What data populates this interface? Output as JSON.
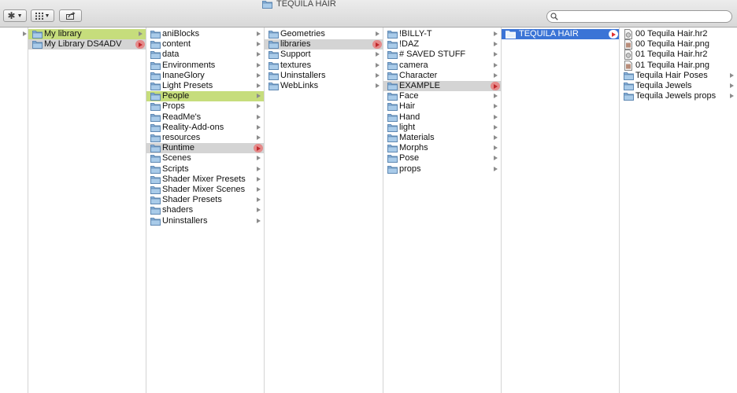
{
  "window": {
    "title": "TEQUILA HAIR"
  },
  "toolbar": {
    "search_placeholder": ""
  },
  "icons": {
    "action": "gear-icon",
    "view": "grid-view-icon",
    "share": "share-icon",
    "search": "search-icon",
    "folder": "folder-icon",
    "file": "file-icon"
  },
  "colors": {
    "green_selection": "#c6dd7c",
    "gray_selection": "#d4d4d4",
    "blue_selection": "#3b74d6",
    "arrow_pill": "#e58a8a"
  },
  "columns": [
    {
      "items": [
        {
          "name": "My library",
          "kind": "folder",
          "arrow": true,
          "state": "green"
        },
        {
          "name": "My Library DS4ADV",
          "kind": "folder",
          "arrow": true,
          "state": "gray",
          "pill": true
        }
      ]
    },
    {
      "items": [
        {
          "name": "aniBlocks",
          "kind": "folder",
          "arrow": true
        },
        {
          "name": "content",
          "kind": "folder",
          "arrow": true
        },
        {
          "name": "data",
          "kind": "folder",
          "arrow": true
        },
        {
          "name": "Environments",
          "kind": "folder",
          "arrow": true
        },
        {
          "name": "InaneGlory",
          "kind": "folder",
          "arrow": true
        },
        {
          "name": "Light Presets",
          "kind": "folder",
          "arrow": true
        },
        {
          "name": "People",
          "kind": "folder",
          "arrow": true,
          "state": "green"
        },
        {
          "name": "Props",
          "kind": "folder",
          "arrow": true
        },
        {
          "name": "ReadMe's",
          "kind": "folder",
          "arrow": true
        },
        {
          "name": "Reality-Add-ons",
          "kind": "folder",
          "arrow": true
        },
        {
          "name": "resources",
          "kind": "folder",
          "arrow": true
        },
        {
          "name": "Runtime",
          "kind": "folder",
          "arrow": true,
          "state": "gray",
          "pill": true
        },
        {
          "name": "Scenes",
          "kind": "folder",
          "arrow": true
        },
        {
          "name": "Scripts",
          "kind": "folder",
          "arrow": true
        },
        {
          "name": "Shader Mixer Presets",
          "kind": "folder",
          "arrow": true
        },
        {
          "name": "Shader Mixer Scenes",
          "kind": "folder",
          "arrow": true
        },
        {
          "name": "Shader Presets",
          "kind": "folder",
          "arrow": true
        },
        {
          "name": "shaders",
          "kind": "folder",
          "arrow": true
        },
        {
          "name": "Uninstallers",
          "kind": "folder",
          "arrow": true
        }
      ]
    },
    {
      "items": [
        {
          "name": "Geometries",
          "kind": "folder",
          "arrow": true
        },
        {
          "name": "libraries",
          "kind": "folder",
          "arrow": true,
          "state": "gray",
          "pill": true
        },
        {
          "name": "Support",
          "kind": "folder",
          "arrow": true
        },
        {
          "name": "textures",
          "kind": "folder",
          "arrow": true
        },
        {
          "name": "Uninstallers",
          "kind": "folder",
          "arrow": true
        },
        {
          "name": "WebLinks",
          "kind": "folder",
          "arrow": true
        }
      ]
    },
    {
      "items": [
        {
          "name": "!BILLY-T",
          "kind": "folder",
          "arrow": true
        },
        {
          "name": "!DAZ",
          "kind": "folder",
          "arrow": true
        },
        {
          "name": "# SAVED STUFF",
          "kind": "folder",
          "arrow": true
        },
        {
          "name": "camera",
          "kind": "folder",
          "arrow": true
        },
        {
          "name": "Character",
          "kind": "folder",
          "arrow": true
        },
        {
          "name": "EXAMPLE",
          "kind": "folder",
          "arrow": true,
          "state": "gray",
          "pill": true
        },
        {
          "name": "Face",
          "kind": "folder",
          "arrow": true
        },
        {
          "name": "Hair",
          "kind": "folder",
          "arrow": true
        },
        {
          "name": "Hand",
          "kind": "folder",
          "arrow": true
        },
        {
          "name": "light",
          "kind": "folder",
          "arrow": true
        },
        {
          "name": "Materials",
          "kind": "folder",
          "arrow": true
        },
        {
          "name": "Morphs",
          "kind": "folder",
          "arrow": true
        },
        {
          "name": "Pose",
          "kind": "folder",
          "arrow": true
        },
        {
          "name": "props",
          "kind": "folder",
          "arrow": true
        }
      ]
    },
    {
      "items": [
        {
          "name": "TEQUILA HAIR",
          "kind": "folder",
          "arrow": true,
          "state": "blue",
          "pill": true
        }
      ]
    },
    {
      "items": [
        {
          "name": "00 Tequila Hair.hr2",
          "kind": "file-hr2",
          "arrow": false
        },
        {
          "name": "00 Tequila Hair.png",
          "kind": "file-png",
          "arrow": false
        },
        {
          "name": "01 Tequila Hair.hr2",
          "kind": "file-hr2",
          "arrow": false
        },
        {
          "name": "01 Tequila Hair.png",
          "kind": "file-png",
          "arrow": false
        },
        {
          "name": "Tequila Hair Poses",
          "kind": "folder",
          "arrow": true
        },
        {
          "name": "Tequila Jewels",
          "kind": "folder",
          "arrow": true
        },
        {
          "name": "Tequila Jewels props",
          "kind": "folder",
          "arrow": true
        }
      ]
    }
  ]
}
